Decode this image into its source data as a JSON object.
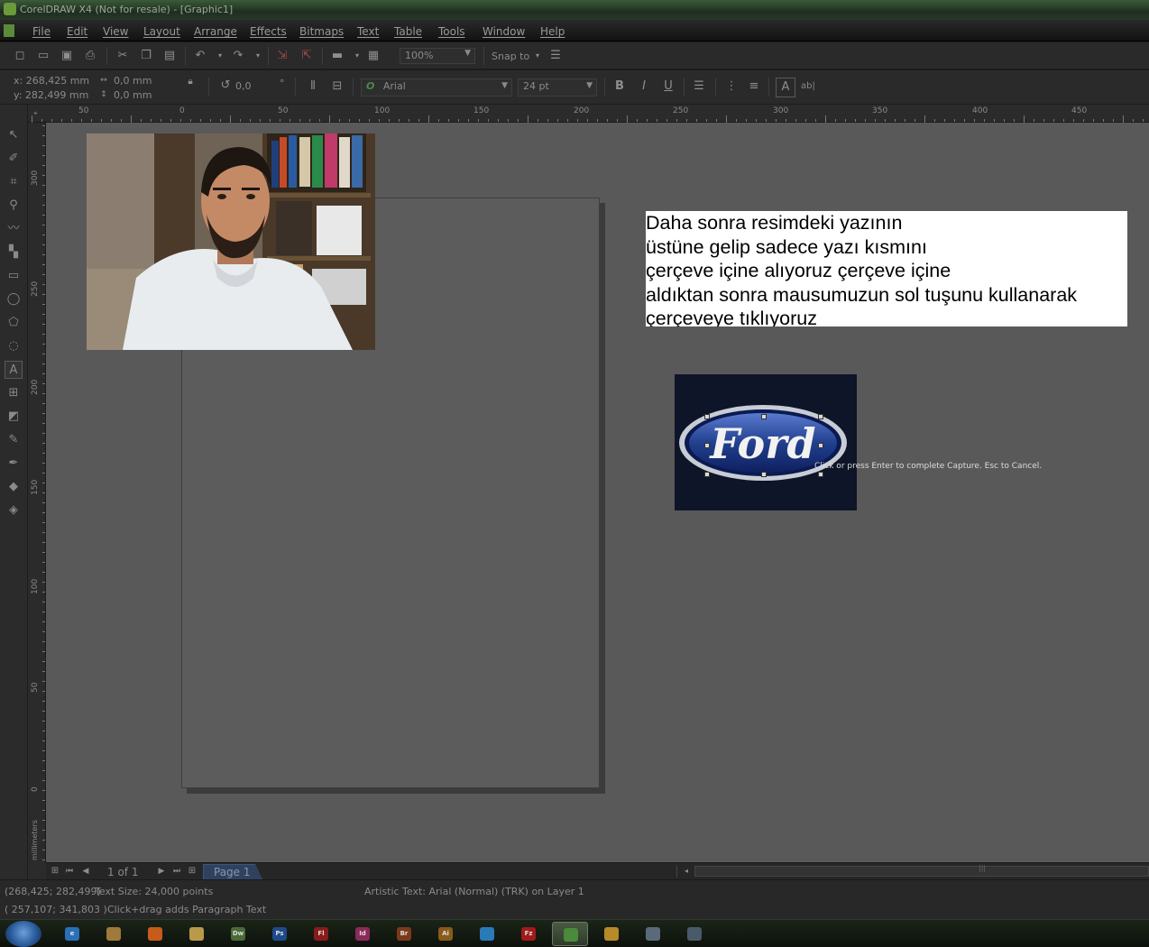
{
  "window": {
    "title": "CorelDRAW X4 (Not for resale) - [Graphic1]"
  },
  "menu": [
    "File",
    "Edit",
    "View",
    "Layout",
    "Arrange",
    "Effects",
    "Bitmaps",
    "Text",
    "Table",
    "Tools",
    "Window",
    "Help"
  ],
  "toolbar": {
    "zoom": "100%",
    "snap_to": "Snap to",
    "x_pos": "x: 268,425 mm",
    "y_pos": "y: 282,499 mm",
    "width": "0,0 mm",
    "height": "0,0 mm",
    "rotation": "0,0",
    "degree": "°",
    "font": "Arial",
    "font_size": "24 pt",
    "abl": "ab|"
  },
  "ruler_h": [
    "50",
    "0",
    "50",
    "100",
    "150",
    "200",
    "250",
    "300",
    "350",
    "400",
    "450"
  ],
  "ruler_v": [
    "300",
    "250",
    "200",
    "150",
    "100",
    "50",
    "0",
    "millimeters"
  ],
  "canvas": {
    "note_lines": [
      "Daha sonra resimdeki yazının",
      "üstüne gelip sadece yazı kısmını",
      "çerçeve içine alıyoruz çerçeve içine",
      "aldıktan sonra mausumuzun sol tuşunu kullanarak",
      "çerçeveye tıklıyoruz"
    ],
    "logo_text": "Ford",
    "capture_hint": "Click or press Enter to complete Capture.  Esc to Cancel."
  },
  "nav": {
    "page_count": "1 of 1",
    "page_tab": "Page 1"
  },
  "status": {
    "coords": "(268,425; 282,499)",
    "text_size": "Text Size: 24,000 points",
    "object_info": "Artistic Text: Arial (Normal) (TRK) on Layer 1",
    "cursor": "( 257,107; 341,803 )",
    "hint": "Click+drag adds Paragraph Text"
  },
  "taskbar": {
    "apps": [
      {
        "name": "ie",
        "label": "e",
        "color": "#2a6fb8"
      },
      {
        "name": "explorer-alt",
        "label": "",
        "color": "#a07a3a"
      },
      {
        "name": "firefox",
        "label": "",
        "color": "#c85a1a"
      },
      {
        "name": "explorer",
        "label": "",
        "color": "#b89a4a"
      },
      {
        "name": "dreamweaver",
        "label": "Dw",
        "color": "#4a6a3a"
      },
      {
        "name": "photoshop",
        "label": "Ps",
        "color": "#1d4a8a"
      },
      {
        "name": "flash",
        "label": "Fl",
        "color": "#8a1a1a"
      },
      {
        "name": "indesign",
        "label": "Id",
        "color": "#8a2a5a"
      },
      {
        "name": "bridge",
        "label": "Br",
        "color": "#7a3a1a"
      },
      {
        "name": "illustrator",
        "label": "Ai",
        "color": "#8a5a1a"
      },
      {
        "name": "app-blue",
        "label": "",
        "color": "#2a7ab8"
      },
      {
        "name": "filezilla",
        "label": "Fz",
        "color": "#a01a1a"
      },
      {
        "name": "coreldraw",
        "label": "",
        "color": "#4a8a3a"
      },
      {
        "name": "media-player",
        "label": "",
        "color": "#b88a2a"
      },
      {
        "name": "app-gray",
        "label": "",
        "color": "#5a6a7a"
      },
      {
        "name": "app-window",
        "label": "",
        "color": "#4a5a6a"
      }
    ]
  },
  "colors": {
    "canvas": "#595959",
    "page": "#5c5c5c",
    "note_bg": "#ffffff"
  }
}
